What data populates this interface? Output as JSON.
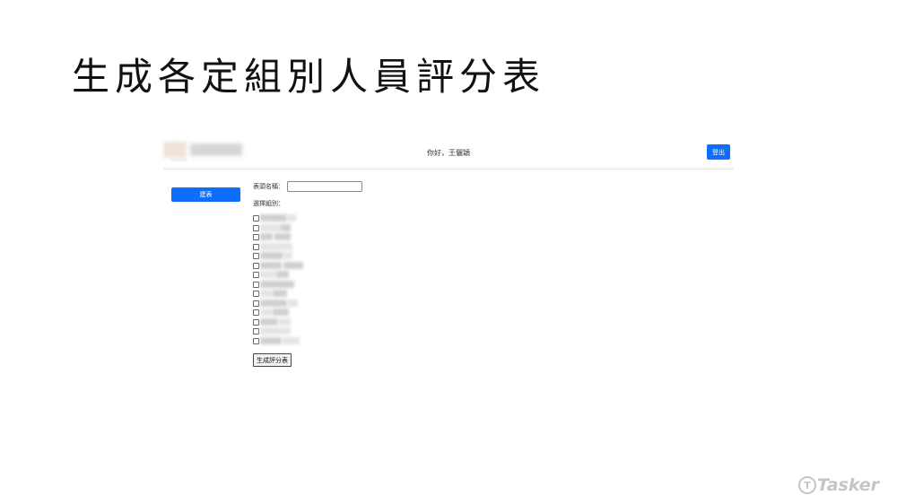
{
  "slide": {
    "title": "生成各定組別人員評分表"
  },
  "header": {
    "greeting": "你好，王儷穎",
    "logout_label": "登出"
  },
  "sidebar": {
    "button_label": "建表"
  },
  "form": {
    "name_label": "表頭名稱：",
    "name_value": "",
    "groups_label": "選擇組別：",
    "group_count": 14,
    "generate_label": "生成評分表"
  },
  "brand": {
    "name": "Tasker",
    "icon": "tasker-logo-icon"
  },
  "colors": {
    "primary": "#0d6efd",
    "brand": "#c2c5ca"
  }
}
